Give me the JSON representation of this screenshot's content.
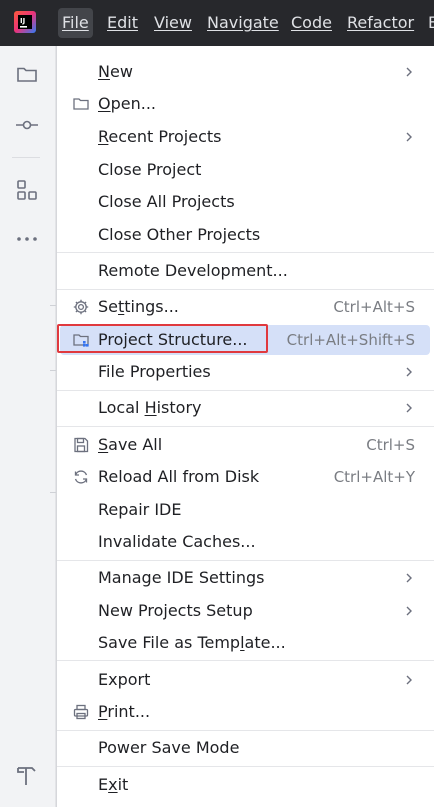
{
  "menubar": {
    "items": [
      {
        "label": "File",
        "active": true
      },
      {
        "label": "Edit"
      },
      {
        "label": "View"
      },
      {
        "label": "Navigate"
      },
      {
        "label": "Code"
      },
      {
        "label": "Refactor"
      },
      {
        "label": "B"
      }
    ]
  },
  "menu": {
    "new": "New",
    "open": "Open...",
    "recent_projects": "Recent Projects",
    "close_project": "Close Project",
    "close_all_projects": "Close All Projects",
    "close_other_projects": "Close Other Projects",
    "remote_development": "Remote Development...",
    "settings": "Settings...",
    "settings_shortcut": "Ctrl+Alt+S",
    "project_structure": "Project Structure...",
    "project_structure_shortcut": "Ctrl+Alt+Shift+S",
    "file_properties": "File Properties",
    "local_history": "Local History",
    "save_all": "Save All",
    "save_all_shortcut": "Ctrl+S",
    "reload_all": "Reload All from Disk",
    "reload_all_shortcut": "Ctrl+Alt+Y",
    "repair_ide": "Repair IDE",
    "invalidate_caches": "Invalidate Caches...",
    "manage_ide_settings": "Manage IDE Settings",
    "new_projects_setup": "New Projects Setup",
    "save_file_as_template": "Save File as Template...",
    "export": "Export",
    "print": "Print...",
    "power_save_mode": "Power Save Mode",
    "exit": "Exit"
  },
  "colors": {
    "accent": "#3574f0",
    "selection": "#d5e0f8",
    "highlight_border": "#e0393e"
  }
}
